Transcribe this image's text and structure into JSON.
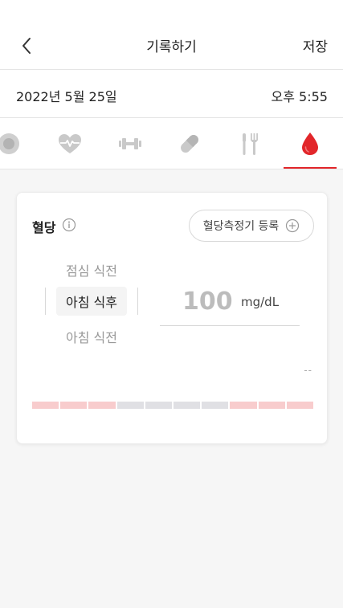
{
  "header": {
    "title": "기록하기",
    "save_label": "저장",
    "back_icon": "chevron-left-icon"
  },
  "record": {
    "date": "2022년 5월 25일",
    "time": "오후 5:55"
  },
  "categories": [
    {
      "name": "circle-record-icon",
      "active": false
    },
    {
      "name": "heart-pulse-icon",
      "active": false
    },
    {
      "name": "dumbbell-icon",
      "active": false
    },
    {
      "name": "pill-icon",
      "active": false
    },
    {
      "name": "fork-knife-icon",
      "active": false
    },
    {
      "name": "blood-drop-icon",
      "active": true
    }
  ],
  "card": {
    "title": "혈당",
    "meter_button": "혈당측정기 등록",
    "timing_options": [
      "점심 식전",
      "아침 식후",
      "아침 식전"
    ],
    "selected_timing": "아침 식후",
    "value": "100",
    "unit": "mg/dL",
    "range_label": "--"
  },
  "range_bar": {
    "colors": {
      "pink": "#f8cccd",
      "gray": "#e0e0e4"
    },
    "segments": [
      "pink",
      "pink",
      "pink",
      "gray",
      "gray",
      "gray",
      "gray",
      "pink",
      "pink",
      "pink"
    ]
  },
  "colors": {
    "accent": "#e2262a",
    "background": "#f6f6f6"
  }
}
